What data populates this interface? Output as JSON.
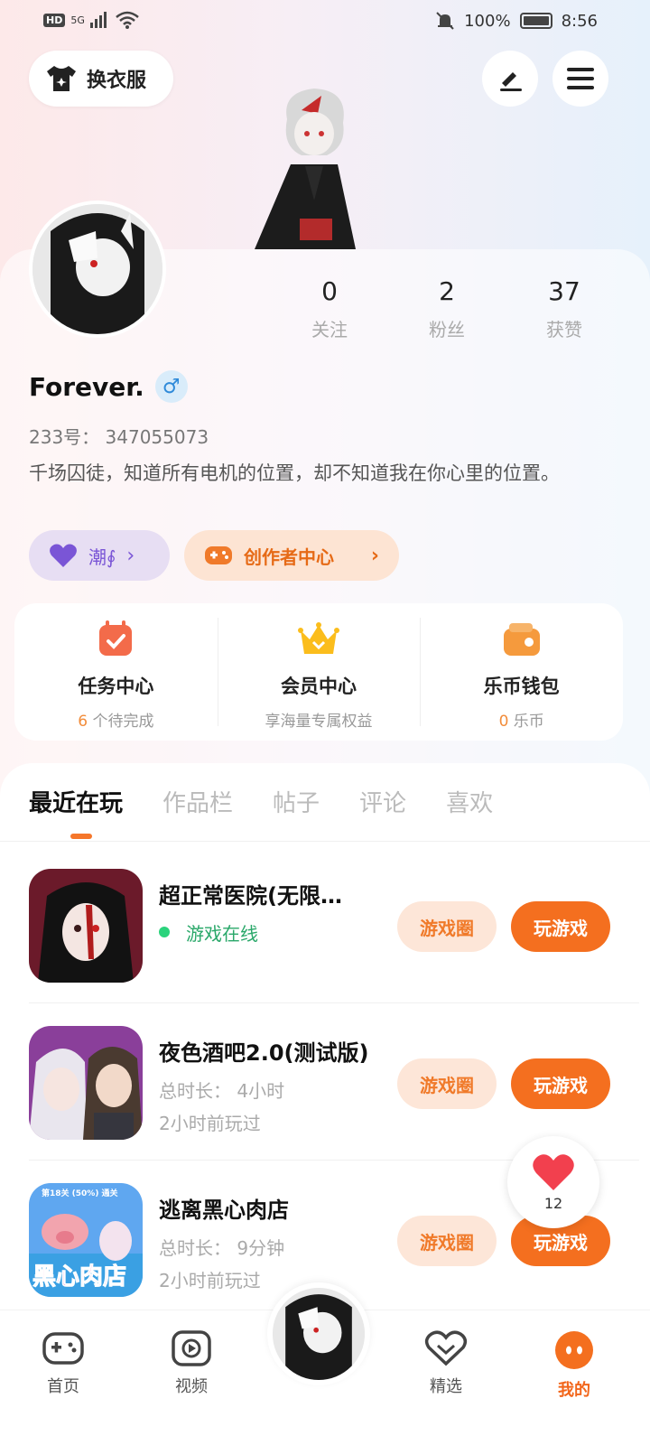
{
  "status_bar": {
    "hd": "HD",
    "signal": "5G",
    "battery_text": "100%",
    "time": "8:56"
  },
  "header": {
    "outfit_label": "换衣服"
  },
  "profile": {
    "stats": [
      {
        "value": "0",
        "label": "关注"
      },
      {
        "value": "2",
        "label": "粉丝"
      },
      {
        "value": "37",
        "label": "获赞"
      }
    ],
    "name": "Forever.",
    "gender_symbol": "♂",
    "uid": "233号： 347055073",
    "bio": "千场囚徒，知道所有电机的位置，却不知道我在你心里的位置。",
    "tag_left": "潮∮",
    "tag_right": "创作者中心"
  },
  "shortcuts": [
    {
      "title": "任务中心",
      "sub_hl": "6",
      "sub": " 个待完成"
    },
    {
      "title": "会员中心",
      "sub_hl": "",
      "sub": "享海量专属权益"
    },
    {
      "title": "乐币钱包",
      "sub_hl": "0",
      "sub": " 乐币"
    }
  ],
  "tabs": [
    "最近在玩",
    "作品栏",
    "帖子",
    "评论",
    "喜欢"
  ],
  "games": [
    {
      "title": "超正常医院(无限…",
      "meta1": "游戏在线",
      "meta2": "",
      "circle_btn": "游戏圈",
      "play_btn": "玩游戏"
    },
    {
      "title": "夜色酒吧2.0(测试版)",
      "meta1": "总时长： 4小时",
      "meta2": "2小时前玩过",
      "circle_btn": "游戏圈",
      "play_btn": "玩游戏"
    },
    {
      "title": "逃离黑心肉店",
      "meta1": "总时长： 9分钟",
      "meta2": "2小时前玩过",
      "circle_btn": "游戏圈",
      "play_btn": "玩游戏",
      "thumb_text": "黑心肉店",
      "thumb_banner": "第18关 (50%) 通关"
    }
  ],
  "like_fab": {
    "count": "12"
  },
  "bottom_nav": [
    {
      "label": "首页"
    },
    {
      "label": "视频"
    },
    {
      "label": "精选"
    },
    {
      "label": "我的"
    }
  ],
  "colors": {
    "accent": "#f46f1f",
    "online": "#2bd37c",
    "tag_purple": "#7a55d6"
  }
}
